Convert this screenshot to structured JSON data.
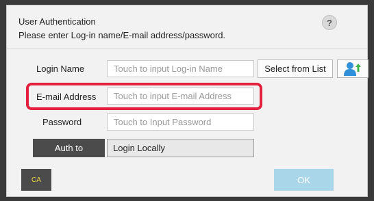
{
  "dialog": {
    "title": "User Authentication",
    "help_label": "?",
    "subtitle": "Please enter Log-in name/E-mail address/password."
  },
  "login_name": {
    "label": "Login Name",
    "placeholder": "Touch to input Log-in Name"
  },
  "select_from_list_label": "Select from List",
  "user_icon": "user-add-icon",
  "email": {
    "label": "E-mail Address",
    "placeholder": "Touch to input E-mail Address"
  },
  "password": {
    "label": "Password",
    "placeholder": "Touch to Input Password"
  },
  "auth_to": {
    "label": "Auth to",
    "value": "Login Locally"
  },
  "footer": {
    "ca_label": "CA",
    "ok_label": "OK"
  },
  "colors": {
    "highlight": "#e3213f",
    "ok_button": "#a9d6e9",
    "dark_button": "#4b4b4b",
    "icon_blue": "#2f8fd8",
    "icon_green": "#3bb44a"
  }
}
